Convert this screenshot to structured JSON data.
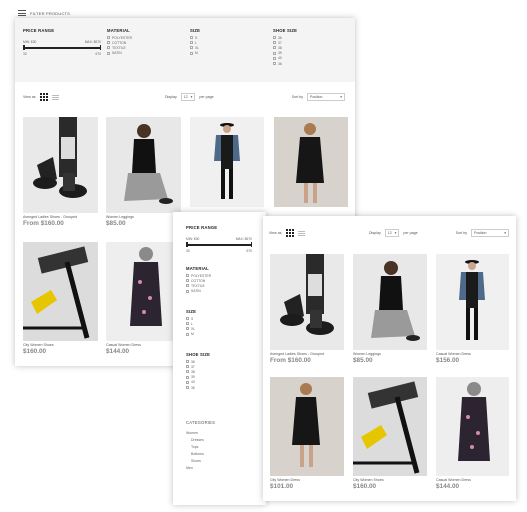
{
  "topbar": {
    "title": "FILTER PRODUCTS"
  },
  "filters": {
    "price": {
      "title": "PRICE RANGE",
      "min": "MIN: $30",
      "max": "MAX: $670",
      "tick_min": "30",
      "tick_max": "670"
    },
    "material": {
      "title": "MATERIAL",
      "options": [
        "POLYESTER",
        "COTTON",
        "TEXTILE",
        "SATIN"
      ]
    },
    "size": {
      "title": "SIZE",
      "options": [
        "S",
        "L",
        "XL",
        "M"
      ]
    },
    "shoe": {
      "title": "SHOE SIZE",
      "options": [
        "36",
        "37",
        "38",
        "39",
        "40",
        "36"
      ]
    }
  },
  "toolbar": {
    "view_as": "View as",
    "display": "Display",
    "display_value": "12",
    "per_page": "per page",
    "sort_by": "Sort by",
    "sort_value": "Position"
  },
  "products_top": [
    {
      "name": "Avenged Ladies Shoes - Grouped",
      "price": "From $160.00"
    },
    {
      "name": "Women Leggings",
      "price": "$85.00"
    },
    {
      "name": "",
      "price": ""
    },
    {
      "name": "",
      "price": ""
    },
    {
      "name": "City Women Shoes",
      "price": "$160.00"
    },
    {
      "name": "Casual Women Dress",
      "price": "$144.00"
    }
  ],
  "sidebar": {
    "price": {
      "title": "PRICE RANGE",
      "min": "MIN: $30",
      "max": "MAX: $670",
      "tick_min": "30",
      "tick_max": "670"
    },
    "material": {
      "title": "MATERIAL",
      "options": [
        "POLYESTER",
        "COTTON",
        "TEXTILE",
        "SATIN"
      ]
    },
    "size": {
      "title": "SIZE",
      "options": [
        "S",
        "L",
        "XL",
        "M"
      ]
    },
    "shoe": {
      "title": "SHOE SIZE",
      "options": [
        "36",
        "37",
        "38",
        "39",
        "40",
        "36"
      ]
    },
    "categories": {
      "title": "CATEGORIES",
      "items": [
        "Women",
        "Dresses",
        "Tops",
        "Bottoms",
        "Shoes",
        "Men"
      ]
    }
  },
  "products_front": [
    {
      "name": "Avenged Ladies Shoes - Grouped",
      "price": "From $160.00"
    },
    {
      "name": "Women Leggings",
      "price": "$85.00"
    },
    {
      "name": "Casual Women Dress",
      "price": "$156.00"
    },
    {
      "name": "City Women Dress",
      "price": "$101.00"
    },
    {
      "name": "City Women Shoes",
      "price": "$160.00"
    },
    {
      "name": "Casual Women Dress",
      "price": "$144.00"
    }
  ],
  "colors": {
    "accent": "#222222",
    "band": "#f4f4f4",
    "price": "#888888"
  }
}
